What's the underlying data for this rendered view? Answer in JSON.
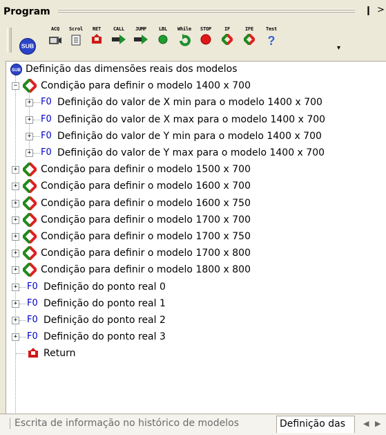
{
  "panel": {
    "title": "Program",
    "pin_glyph": "❙",
    "close_glyph": ">"
  },
  "toolbar": {
    "buttons": [
      {
        "label": "",
        "icon": "sub-icon"
      },
      {
        "label": "ACQ",
        "icon": "camera-icon"
      },
      {
        "label": "Scrol",
        "icon": "scroll-icon"
      },
      {
        "label": "RET",
        "icon": "return-icon"
      },
      {
        "label": "CALL",
        "icon": "call-arrow-icon"
      },
      {
        "label": "JUMP",
        "icon": "jump-arrow-icon"
      },
      {
        "label": "LBL",
        "icon": "label-dot-icon"
      },
      {
        "label": "While",
        "icon": "while-loop-icon"
      },
      {
        "label": "STOP",
        "icon": "stop-icon"
      },
      {
        "label": "IF",
        "icon": "if-diamond-icon"
      },
      {
        "label": "IFE",
        "icon": "ife-diamond-icon"
      },
      {
        "label": "Test",
        "icon": "question-icon"
      }
    ],
    "overflow": "▾"
  },
  "tree": {
    "root": {
      "badge": "SUB",
      "label": "Definição das dimensões reais dos modelos"
    },
    "fo_prefix": "F0",
    "expanded_condition": "Condição para definir o modelo 1400 x 700",
    "children": [
      "Definição do valor de X min para o modelo 1400 x 700",
      "Definição do valor de X max para o modelo 1400 x 700",
      "Definição do valor de Y min para o modelo 1400 x 700",
      "Definição do valor de Y max para o modelo 1400 x 700"
    ],
    "conditions": [
      "Condição para definir o modelo 1500 x 700",
      "Condição para definir o modelo 1600 x 700",
      "Condição para definir o modelo 1600 x 750",
      "Condição para definir o modelo 1700 x 700",
      "Condição para definir o modelo 1700 x 750",
      "Condição para definir o modelo 1700 x 800",
      "Condição para definir o modelo 1800 x 800"
    ],
    "points": [
      "Definição do ponto real 0",
      "Definição do ponto real 1",
      "Definição do ponto real 2",
      "Definição do ponto real 3"
    ],
    "return_label": "Return",
    "expand_glyph": "+",
    "collapse_glyph": "−"
  },
  "tabs": {
    "inactive": "Escrita de informação no histórico de modelos",
    "active": "Definição das",
    "left_arrow": "◀",
    "right_arrow": "▶"
  },
  "colors": {
    "condition_green": "#1c8c1c",
    "condition_red": "#e02020",
    "fo_blue": "#0000c8",
    "sub_blue": "#2040c0"
  }
}
